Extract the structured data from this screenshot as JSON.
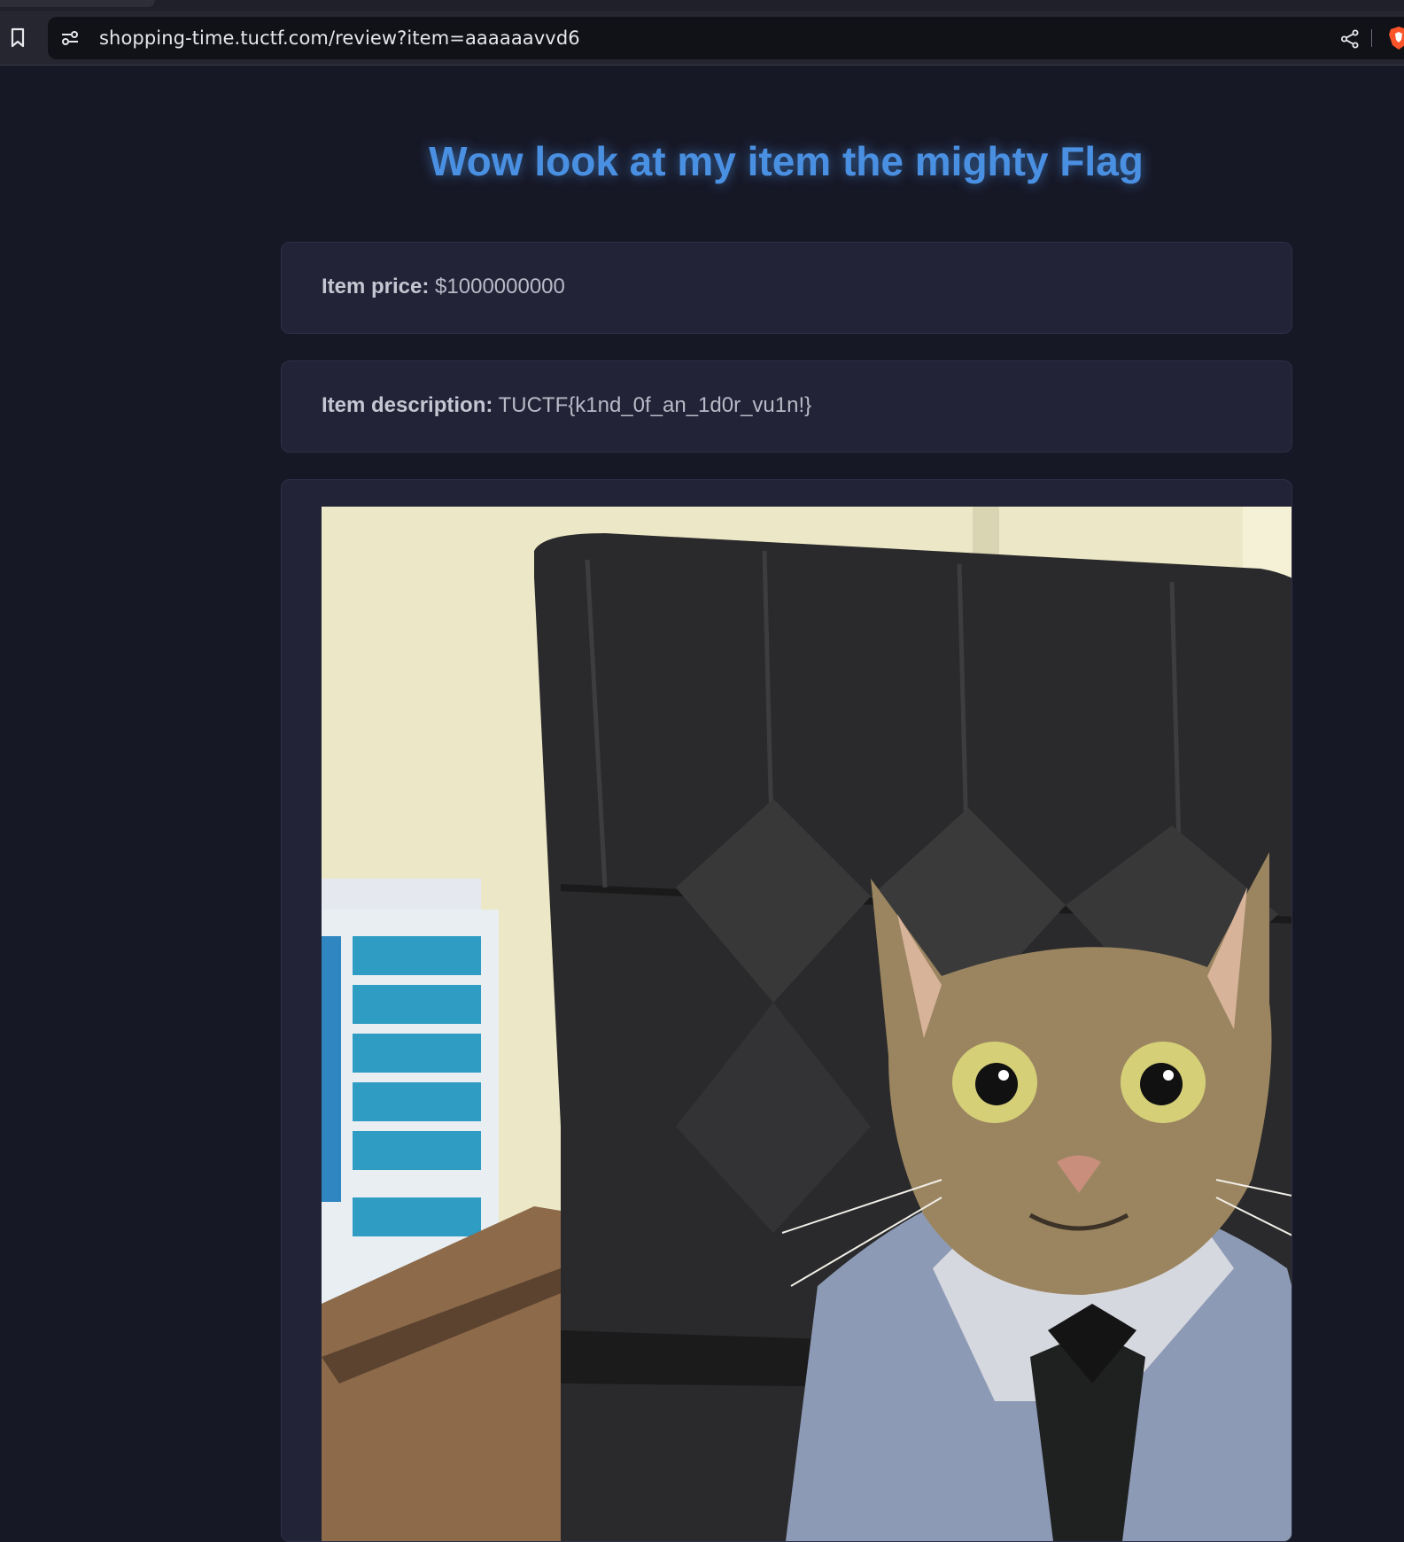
{
  "browser": {
    "url": "shopping-time.tuctf.com/review?item=aaaaaavvd6",
    "icons": {
      "bookmark": "bookmark-icon",
      "site_info": "site-settings-icon",
      "share": "share-icon",
      "shields": "brave-shield-icon"
    }
  },
  "page": {
    "title": "Wow look at my item the mighty Flag",
    "price": {
      "label": "Item price:",
      "value": "$1000000000"
    },
    "description": {
      "label": "Item description:",
      "value": "TUCTF{k1nd_0f_an_1d0r_vu1n!}"
    },
    "image": {
      "subject": "cat in office chair wearing shirt and tie"
    }
  },
  "colors": {
    "background": "#171826",
    "card": "#222336",
    "title": "#4a90e2",
    "text": "#b8bac7"
  }
}
